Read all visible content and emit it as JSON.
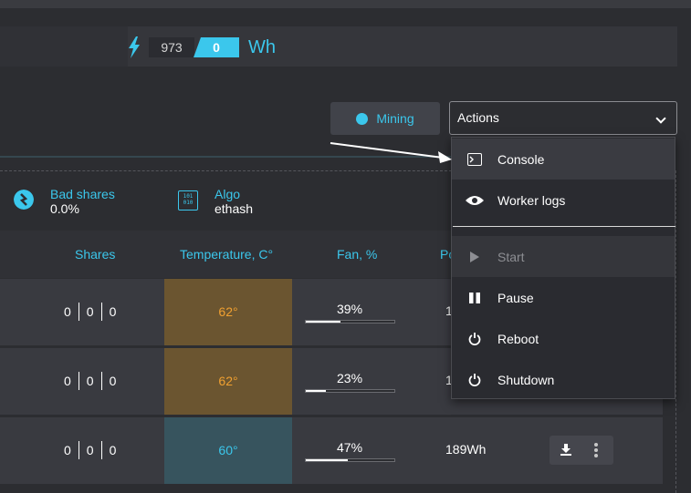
{
  "power": {
    "value": "973",
    "zero": "0",
    "unit": "Wh"
  },
  "toolbar": {
    "mining_label": "Mining",
    "actions_label": "Actions"
  },
  "stats": {
    "bad_shares_label": "Bad shares",
    "bad_shares_value": "0.0%",
    "algo_label": "Algo",
    "algo_value": "ethash",
    "algo_icon_text": "101 010"
  },
  "table": {
    "headers": {
      "shares": "Shares",
      "temperature": "Temperature, C°",
      "fan": "Fan, %",
      "power": "Po"
    },
    "rows": [
      {
        "shares": [
          "0",
          "0",
          "0"
        ],
        "temp": "62°",
        "fan": "39%",
        "fan_level": 0.39,
        "power": "1"
      },
      {
        "shares": [
          "0",
          "0",
          "0"
        ],
        "temp": "62°",
        "fan": "23%",
        "fan_level": 0.23,
        "power": "1"
      },
      {
        "shares": [
          "0",
          "0",
          "0"
        ],
        "temp": "60°",
        "fan": "47%",
        "fan_level": 0.47,
        "power": "189Wh"
      }
    ]
  },
  "dropdown": {
    "items": [
      {
        "label": "Console",
        "icon": "terminal-icon"
      },
      {
        "label": "Worker logs",
        "icon": "eye-icon"
      },
      {
        "label": "Start",
        "icon": "play-icon"
      },
      {
        "label": "Pause",
        "icon": "pause-icon"
      },
      {
        "label": "Reboot",
        "icon": "power-icon"
      },
      {
        "label": "Shutdown",
        "icon": "power-icon"
      }
    ]
  },
  "colors": {
    "accent": "#3bc7ec",
    "warm_temp": "#6b5530",
    "cool_temp": "#37545e",
    "warm_text": "#f0a030"
  }
}
